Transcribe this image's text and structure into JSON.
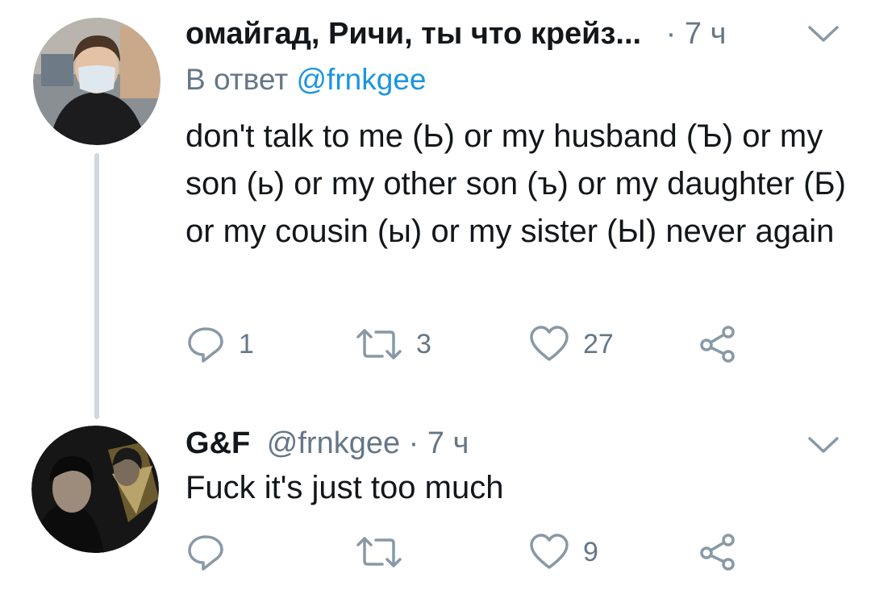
{
  "tweets": [
    {
      "display_name": "омайгад, Ричи, ты что крейз...",
      "time": "· 7 ч",
      "reply_prefix": "В ответ",
      "reply_mention": "@frnkgee",
      "text": "don't talk to me (Ь) or my husband (Ъ) or my son (ь) or my other son (ъ) or my daughter (Б) or my cousin (ы) or my sister (Ы) never again",
      "counts": {
        "replies": "1",
        "retweets": "3",
        "likes": "27"
      },
      "icons": [
        "reply-icon",
        "retweet-icon",
        "like-icon",
        "share-icon",
        "chevron-down-icon"
      ]
    },
    {
      "display_name": "G&F",
      "handle_time": "@frnkgee · 7 ч",
      "text": "Fuck it's just too much",
      "counts": {
        "likes": "9"
      },
      "icons": [
        "reply-icon",
        "retweet-icon",
        "like-icon",
        "share-icon",
        "chevron-down-icon"
      ]
    }
  ],
  "colors": {
    "text": "#14171a",
    "secondary": "#657786",
    "link": "#1b95e0",
    "thread_line": "#cfd9de"
  }
}
